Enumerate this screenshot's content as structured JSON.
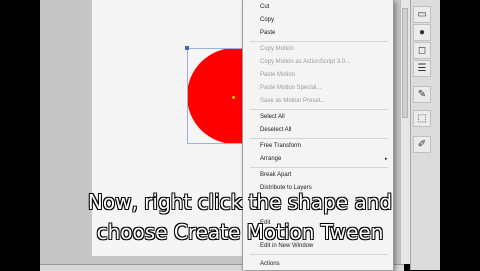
{
  "context_menu": {
    "items": [
      {
        "label": "Cut",
        "enabled": true
      },
      {
        "label": "Copy",
        "enabled": true
      },
      {
        "label": "Paste",
        "enabled": true
      },
      {
        "label": "Copy Motion",
        "enabled": false
      },
      {
        "label": "Copy Motion as ActionScript 3.0...",
        "enabled": false
      },
      {
        "label": "Paste Motion",
        "enabled": false
      },
      {
        "label": "Paste Motion Special...",
        "enabled": false
      },
      {
        "label": "Save as Motion Preset...",
        "enabled": false
      },
      {
        "label": "Select All",
        "enabled": true
      },
      {
        "label": "Deselect All",
        "enabled": true
      },
      {
        "label": "Free Transform",
        "enabled": true
      },
      {
        "label": "Arrange",
        "enabled": true
      },
      {
        "label": "Break Apart",
        "enabled": true
      },
      {
        "label": "Distribute to Layers",
        "enabled": true
      },
      {
        "label": "Edit",
        "enabled": true
      },
      {
        "label": "Edit in New Window",
        "enabled": true
      },
      {
        "label": "Actions",
        "enabled": true
      }
    ],
    "submenu_arrow": "▸"
  },
  "caption": {
    "line1": "Now, right click the shape and",
    "line2": "choose Create Motion Tween"
  },
  "toolbar": {
    "icons": [
      "selection-icon",
      "color-icon",
      "fill-icon",
      "stroke-icon",
      "tools-icon",
      "transform-icon",
      "brush-icon"
    ]
  },
  "colors": {
    "shape_fill": "#ff0000",
    "menu_background": "#f4f4f4",
    "disabled_text": "#9a9a9a"
  }
}
